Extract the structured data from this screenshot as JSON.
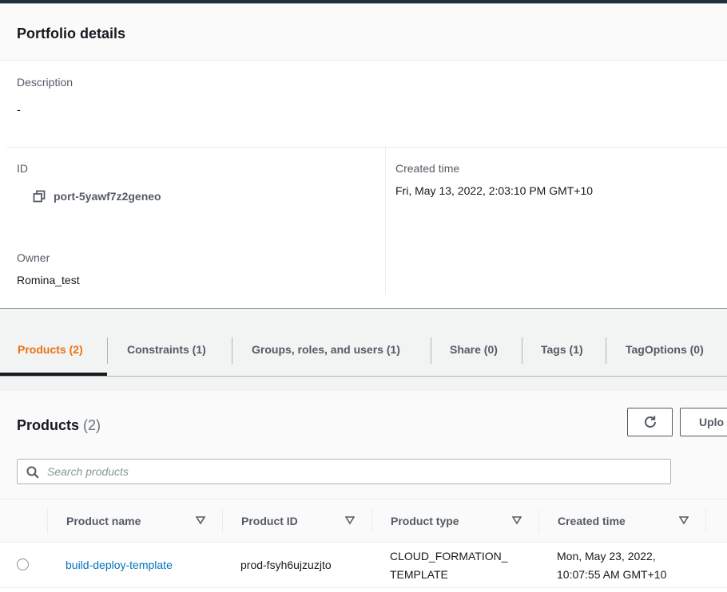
{
  "details": {
    "title": "Portfolio details",
    "description_label": "Description",
    "description_value": "-",
    "id_label": "ID",
    "id_value": "port-5yawf7z2geneo",
    "created_label": "Created time",
    "created_value": "Fri, May 13, 2022, 2:03:10 PM GMT+10",
    "owner_label": "Owner",
    "owner_value": "Romina_test"
  },
  "tabs": [
    {
      "label": "Products (2)",
      "active": true
    },
    {
      "label": "Constraints (1)",
      "active": false
    },
    {
      "label": "Groups, roles, and users (1)",
      "active": false
    },
    {
      "label": "Share (0)",
      "active": false
    },
    {
      "label": "Tags (1)",
      "active": false
    },
    {
      "label": "TagOptions (0)",
      "active": false
    }
  ],
  "products": {
    "title": "Products",
    "count": "(2)",
    "upload_label": "Uplo",
    "search_placeholder": "Search products",
    "columns": [
      "Product name",
      "Product ID",
      "Product type",
      "Created time"
    ],
    "rows": [
      {
        "name": "build-deploy-template",
        "id": "prod-fsyh6ujzuzjto",
        "type_line1": "CLOUD_FORMATION_",
        "type_line2": "TEMPLATE",
        "created_line1": "Mon, May 23, 2022,",
        "created_line2": "10:07:55 AM GMT+10"
      }
    ]
  },
  "colors": {
    "accent_active_tab": "#ec7211",
    "link": "#0073bb",
    "text": "#16191f",
    "muted": "#545b64"
  },
  "icons": [
    "copy-icon",
    "refresh-icon",
    "search-icon",
    "sort-down-icon",
    "radio-button"
  ]
}
